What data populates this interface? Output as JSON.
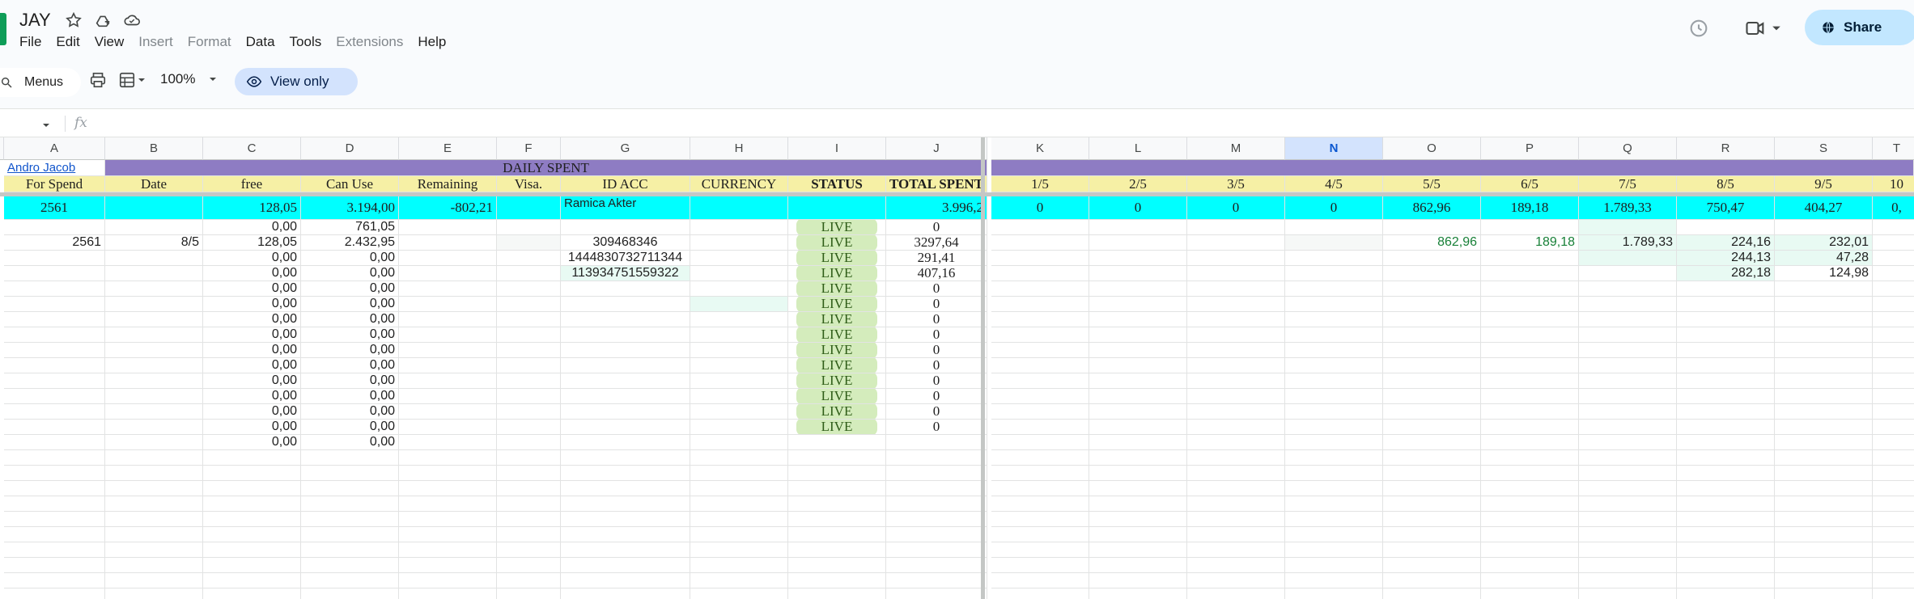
{
  "doc": {
    "title": "JAY",
    "menu": [
      {
        "label": "File",
        "enabled": true
      },
      {
        "label": "Edit",
        "enabled": true
      },
      {
        "label": "View",
        "enabled": true
      },
      {
        "label": "Insert",
        "enabled": false
      },
      {
        "label": "Format",
        "enabled": false
      },
      {
        "label": "Data",
        "enabled": true
      },
      {
        "label": "Tools",
        "enabled": true
      },
      {
        "label": "Extensions",
        "enabled": false
      },
      {
        "label": "Help",
        "enabled": true
      }
    ],
    "share_label": "Share"
  },
  "toolbar": {
    "search_label": "Menus",
    "zoom": "100%",
    "view_only_label": "View only"
  },
  "formula": {
    "fx": "fx"
  },
  "columns": [
    "A",
    "B",
    "C",
    "D",
    "E",
    "F",
    "G",
    "H",
    "I",
    "J",
    "K",
    "L",
    "M",
    "N",
    "O",
    "P",
    "Q",
    "R",
    "S",
    "T"
  ],
  "selected_column": "N",
  "sheet": {
    "link_cell": "Andro Jacob",
    "banner": "DAILY SPENT",
    "headers": [
      "For Spend",
      "Date",
      "free",
      "Can Use",
      "Remaining",
      "Visa.",
      "ID ACC",
      "CURRENCY",
      "STATUS",
      "TOTAL SPENT",
      "1/5",
      "2/5",
      "3/5",
      "4/5",
      "5/5",
      "6/5",
      "7/5",
      "8/5",
      "9/5",
      "10"
    ],
    "summary": {
      "for_spend": "2561",
      "free": "128,05",
      "can_use": "3.194,00",
      "remaining": "-802,21",
      "id_acc": "Ramica Akter",
      "total_spent": "3.996,2",
      "daily": [
        "0",
        "0",
        "0",
        "0",
        "862,96",
        "189,18",
        "1.789,33",
        "750,47",
        "404,27",
        "0,"
      ]
    },
    "rows": [
      {
        "a": "",
        "b": "",
        "c": "0,00",
        "d": "761,05",
        "g": "",
        "status": "LIVE",
        "j": "0",
        "daily": [
          "",
          "",
          "",
          "",
          "",
          "",
          "",
          "",
          ""
        ]
      },
      {
        "a": "2561",
        "b": "8/5",
        "c": "128,05",
        "d": "2.432,95",
        "g": "309468346",
        "status": "LIVE",
        "j": "3297,64",
        "daily": [
          "",
          "",
          "",
          "",
          "862,96",
          "189,18",
          "1.789,33",
          "224,16",
          "232,01"
        ]
      },
      {
        "a": "",
        "b": "",
        "c": "0,00",
        "d": "0,00",
        "g": "1444830732711344",
        "status": "LIVE",
        "j": "291,41",
        "daily": [
          "",
          "",
          "",
          "",
          "",
          "",
          "",
          "244,13",
          "47,28"
        ]
      },
      {
        "a": "",
        "b": "",
        "c": "0,00",
        "d": "0,00",
        "g": "113934751559322",
        "status": "LIVE",
        "j": "407,16",
        "daily": [
          "",
          "",
          "",
          "",
          "",
          "",
          "",
          "282,18",
          "124,98"
        ]
      },
      {
        "a": "",
        "b": "",
        "c": "0,00",
        "d": "0,00",
        "g": "",
        "status": "LIVE",
        "j": "0",
        "daily": [
          "",
          "",
          "",
          "",
          "",
          "",
          "",
          "",
          ""
        ]
      },
      {
        "a": "",
        "b": "",
        "c": "0,00",
        "d": "0,00",
        "g": "",
        "status": "LIVE",
        "j": "0",
        "daily": [
          "",
          "",
          "",
          "",
          "",
          "",
          "",
          "",
          ""
        ]
      },
      {
        "a": "",
        "b": "",
        "c": "0,00",
        "d": "0,00",
        "g": "",
        "status": "LIVE",
        "j": "0",
        "daily": [
          "",
          "",
          "",
          "",
          "",
          "",
          "",
          "",
          ""
        ]
      },
      {
        "a": "",
        "b": "",
        "c": "0,00",
        "d": "0,00",
        "g": "",
        "status": "LIVE",
        "j": "0",
        "daily": [
          "",
          "",
          "",
          "",
          "",
          "",
          "",
          "",
          ""
        ]
      },
      {
        "a": "",
        "b": "",
        "c": "0,00",
        "d": "0,00",
        "g": "",
        "status": "LIVE",
        "j": "0",
        "daily": [
          "",
          "",
          "",
          "",
          "",
          "",
          "",
          "",
          ""
        ]
      },
      {
        "a": "",
        "b": "",
        "c": "0,00",
        "d": "0,00",
        "g": "",
        "status": "LIVE",
        "j": "0",
        "daily": [
          "",
          "",
          "",
          "",
          "",
          "",
          "",
          "",
          ""
        ]
      },
      {
        "a": "",
        "b": "",
        "c": "0,00",
        "d": "0,00",
        "g": "",
        "status": "LIVE",
        "j": "0",
        "daily": [
          "",
          "",
          "",
          "",
          "",
          "",
          "",
          "",
          ""
        ]
      },
      {
        "a": "",
        "b": "",
        "c": "0,00",
        "d": "0,00",
        "g": "",
        "status": "LIVE",
        "j": "0",
        "daily": [
          "",
          "",
          "",
          "",
          "",
          "",
          "",
          "",
          ""
        ]
      },
      {
        "a": "",
        "b": "",
        "c": "0,00",
        "d": "0,00",
        "g": "",
        "status": "LIVE",
        "j": "0",
        "daily": [
          "",
          "",
          "",
          "",
          "",
          "",
          "",
          "",
          ""
        ]
      },
      {
        "a": "",
        "b": "",
        "c": "0,00",
        "d": "0,00",
        "g": "",
        "status": "LIVE",
        "j": "0",
        "daily": [
          "",
          "",
          "",
          "",
          "",
          "",
          "",
          "",
          ""
        ]
      },
      {
        "a": "",
        "b": "",
        "c": "0,00",
        "d": "0,00",
        "g": "",
        "status": "",
        "j": "",
        "daily": [
          "",
          "",
          "",
          "",
          "",
          "",
          "",
          "",
          ""
        ]
      }
    ]
  },
  "colors": {
    "banner": "#8e7cc3",
    "header": "#f6f0a5",
    "summary": "#00ffff",
    "live_chip": "#d4ecbc",
    "green_text": "#188038"
  }
}
